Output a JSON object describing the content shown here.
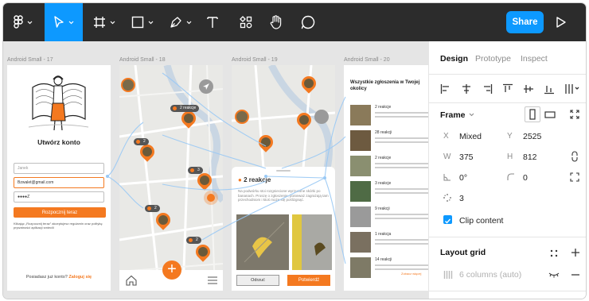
{
  "toolbar": {
    "tools": [
      {
        "name": "figma-menu-icon"
      },
      {
        "name": "move-tool-icon"
      },
      {
        "name": "frame-tool-icon"
      },
      {
        "name": "shape-tool-icon"
      },
      {
        "name": "pen-tool-icon"
      },
      {
        "name": "text-tool-icon"
      },
      {
        "name": "resources-icon"
      },
      {
        "name": "hand-tool-icon"
      },
      {
        "name": "comment-icon"
      }
    ],
    "share_label": "Share",
    "accent": "#0d99ff"
  },
  "canvas": {
    "frames": [
      {
        "label": "Android Small - 17"
      },
      {
        "label": "Android Small - 18"
      },
      {
        "label": "Android Small - 19"
      },
      {
        "label": "Android Small - 20"
      }
    ],
    "screen1": {
      "title": "Utwórz konto",
      "name_placeholder": "Janek",
      "email_value": "Bzwalet@gmail.com",
      "password_value": "●●●●Z",
      "button_label": "Rozpocznij teraz",
      "terms_text": "Klikając „Rozpocznij teraz” akceptujesz regulamin oraz politykę prywatności aplikacji smiecili",
      "login_prompt": "Posiadasz już konto?",
      "login_link": "Zaloguj się"
    },
    "screen2": {
      "badges": [
        "2 reakcje",
        "2",
        "3",
        "2",
        "2"
      ]
    },
    "screen3": {
      "reactions": "2 reakcje",
      "text": "Na podwórku stoi rozgniecione wyrzucone skórki po bananach. Proszę o zgłoszenie, ponieważ zagrażają tam przechodniom i ktoś może się poślizgnąć.",
      "reject": "Odrzuć",
      "confirm": "Potwierdź"
    },
    "screen4": {
      "title": "Wszystkie zgłoszenia w Twojej okolicy",
      "items": [
        {
          "title": "2 reakcje"
        },
        {
          "title": "28 reakcji"
        },
        {
          "title": "2 reakcje"
        },
        {
          "title": "3 reakcje"
        },
        {
          "title": "9 reakcji"
        },
        {
          "title": "1 reakcja"
        },
        {
          "title": "14 reakcji"
        }
      ],
      "more_link": "Zobacz więcej"
    },
    "brand_color": "#f47920"
  },
  "panel": {
    "tabs": [
      "Design",
      "Prototype",
      "Inspect"
    ],
    "frame_title": "Frame",
    "x_label": "X",
    "x_value": "Mixed",
    "y_label": "Y",
    "y_value": "2525",
    "w_label": "W",
    "w_value": "375",
    "h_label": "H",
    "h_value": "812",
    "rotation_value": "0°",
    "radius_value": "0",
    "corner_value": "3",
    "clip_content": "Clip content",
    "layout_grid_title": "Layout grid",
    "grid_value": "6 columns (auto)"
  }
}
